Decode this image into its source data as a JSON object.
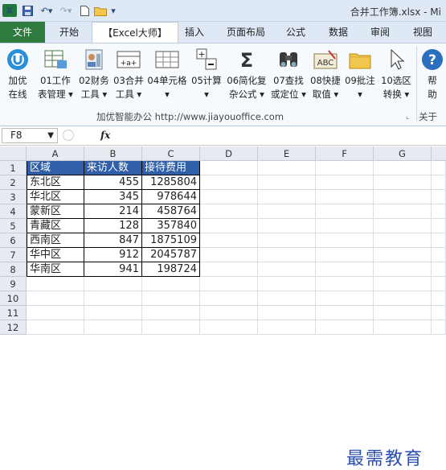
{
  "window": {
    "title": "合并工作簿.xlsx - Mi"
  },
  "tabs": [
    "文件",
    "开始",
    "【Excel大师】",
    "插入",
    "页面布局",
    "公式",
    "数据",
    "审阅",
    "视图"
  ],
  "ribbon": {
    "buttons": [
      {
        "l1": "加优",
        "l2": "在线",
        "icon": "jiayou-online-icon"
      },
      {
        "l1": "01工作",
        "l2": "表管理 ▾",
        "icon": "sheet-manage-icon"
      },
      {
        "l1": "02财务",
        "l2": "工具 ▾",
        "icon": "finance-tools-icon"
      },
      {
        "l1": "03合并",
        "l2": "工具 ▾",
        "icon": "merge-tools-icon"
      },
      {
        "l1": "04单元格",
        "l2": "▾",
        "icon": "cell-tools-icon"
      },
      {
        "l1": "05计算",
        "l2": "▾",
        "icon": "calc-icon"
      },
      {
        "l1": "06简化复",
        "l2": "杂公式 ▾",
        "icon": "sigma-icon"
      },
      {
        "l1": "07查找",
        "l2": "或定位 ▾",
        "icon": "binoculars-icon"
      },
      {
        "l1": "08快捷",
        "l2": "取值 ▾",
        "icon": "abc-icon"
      },
      {
        "l1": "09批注",
        "l2": "▾",
        "icon": "comment-folder-icon"
      },
      {
        "l1": "10选区",
        "l2": "转换 ▾",
        "icon": "cursor-icon"
      },
      {
        "l1": "帮",
        "l2": "助",
        "icon": "help-icon"
      }
    ],
    "group_label": "加优智能办公  http://www.jiayouoffice.com",
    "about_label": "关于"
  },
  "formula_bar": {
    "name_box": "F8",
    "fx": "fx",
    "formula": ""
  },
  "columns": [
    "A",
    "B",
    "C",
    "D",
    "E",
    "F",
    "G"
  ],
  "rows": [
    "1",
    "2",
    "3",
    "4",
    "5",
    "6",
    "7",
    "8",
    "9",
    "10",
    "11",
    "12"
  ],
  "table": {
    "headers": [
      "区域",
      "来访人数",
      "接待费用"
    ],
    "data": [
      [
        "东北区",
        "455",
        "1285804"
      ],
      [
        "华北区",
        "345",
        "978644"
      ],
      [
        "蒙新区",
        "214",
        "458764"
      ],
      [
        "青藏区",
        "128",
        "357840"
      ],
      [
        "西南区",
        "847",
        "1875109"
      ],
      [
        "华中区",
        "912",
        "2045787"
      ],
      [
        "华南区",
        "941",
        "198724"
      ]
    ]
  },
  "watermark": "最需教育",
  "colors": {
    "file_tab": "#2f7a3f",
    "header_fill": "#2e5fa8",
    "watermark": "#2a4fb0"
  }
}
